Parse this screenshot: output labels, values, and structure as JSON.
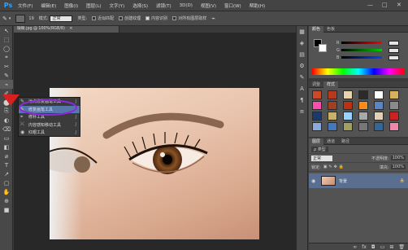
{
  "app": {
    "logo": "Ps"
  },
  "menu": [
    "文件(F)",
    "编辑(E)",
    "图像(I)",
    "图层(L)",
    "文字(Y)",
    "选择(S)",
    "滤镜(T)",
    "3D(D)",
    "视图(V)",
    "窗口(W)",
    "帮助(H)"
  ],
  "window_controls": [
    "—",
    "□",
    "✕"
  ],
  "options": {
    "brush_size": "19",
    "mode_label": "模式:",
    "mode_value": "正常",
    "type_label": "类型:",
    "type_options": [
      "近似匹配",
      "创建纹理",
      "内容识别"
    ],
    "sample_all": "对所有图层取样"
  },
  "document": {
    "tab_title": "眼睛.jpg @ 100%(RGB/8)"
  },
  "tools": [
    "↖",
    "⬚",
    "◯",
    "⌖",
    "✂",
    "✎",
    "⌁",
    "✐",
    "⬤",
    "⎘",
    "◐",
    "⌫",
    "▭",
    "◧",
    "⌀",
    "T",
    "↗",
    "▢",
    "✋",
    "⊕",
    "■"
  ],
  "flyout": {
    "items": [
      {
        "icon": "✎",
        "label": "污点修复画笔工具",
        "key": "J",
        "highlighted": false
      },
      {
        "icon": "✎",
        "label": "修复画笔工具",
        "key": "J",
        "highlighted": true
      },
      {
        "icon": "⌖",
        "label": "修补工具",
        "key": "J",
        "highlighted": false
      },
      {
        "icon": "⤬",
        "label": "内容感知移动工具",
        "key": "J",
        "highlighted": false
      },
      {
        "icon": "◉",
        "label": "红眼工具",
        "key": "J",
        "highlighted": false
      }
    ]
  },
  "dock_icons": [
    "▦",
    "◈",
    "▤",
    "⚙",
    "✎",
    "A",
    "¶",
    "≡"
  ],
  "color_panel": {
    "tabs": [
      "颜色",
      "色板"
    ],
    "sliders": [
      {
        "label": "R",
        "color": "#ff0000"
      },
      {
        "label": "G",
        "color": "#00cc00"
      },
      {
        "label": "B",
        "color": "#0044ff"
      }
    ]
  },
  "adjust_panel": {
    "tabs": [
      "调整",
      "样式"
    ],
    "swatches": [
      "#c84a2a",
      "#b73a1f",
      "#e8d5b0",
      "#2b2b2b",
      "#ffffff",
      "#d9b15a",
      "#ff4ab0",
      "#a04020",
      "#c03010",
      "#ff8a1a",
      "#5a86c8",
      "#8a8a8a",
      "#1b3a6b",
      "#c8b26b",
      "#9bd1ff",
      "#a8a8a8",
      "#dfd2b8",
      "#cc2222",
      "#88aadd",
      "#4477bb",
      "#a0a060",
      "#777777",
      "#336699",
      "#ee88aa"
    ]
  },
  "layers_panel": {
    "tabs": [
      "图层",
      "通道",
      "路径"
    ],
    "kind_label": "ρ 类型",
    "blend_mode": "正常",
    "opacity_label": "不透明度:",
    "opacity_value": "100%",
    "lock_label": "锁定:",
    "fill_label": "填充:",
    "fill_value": "100%",
    "layer_name": "背景"
  }
}
